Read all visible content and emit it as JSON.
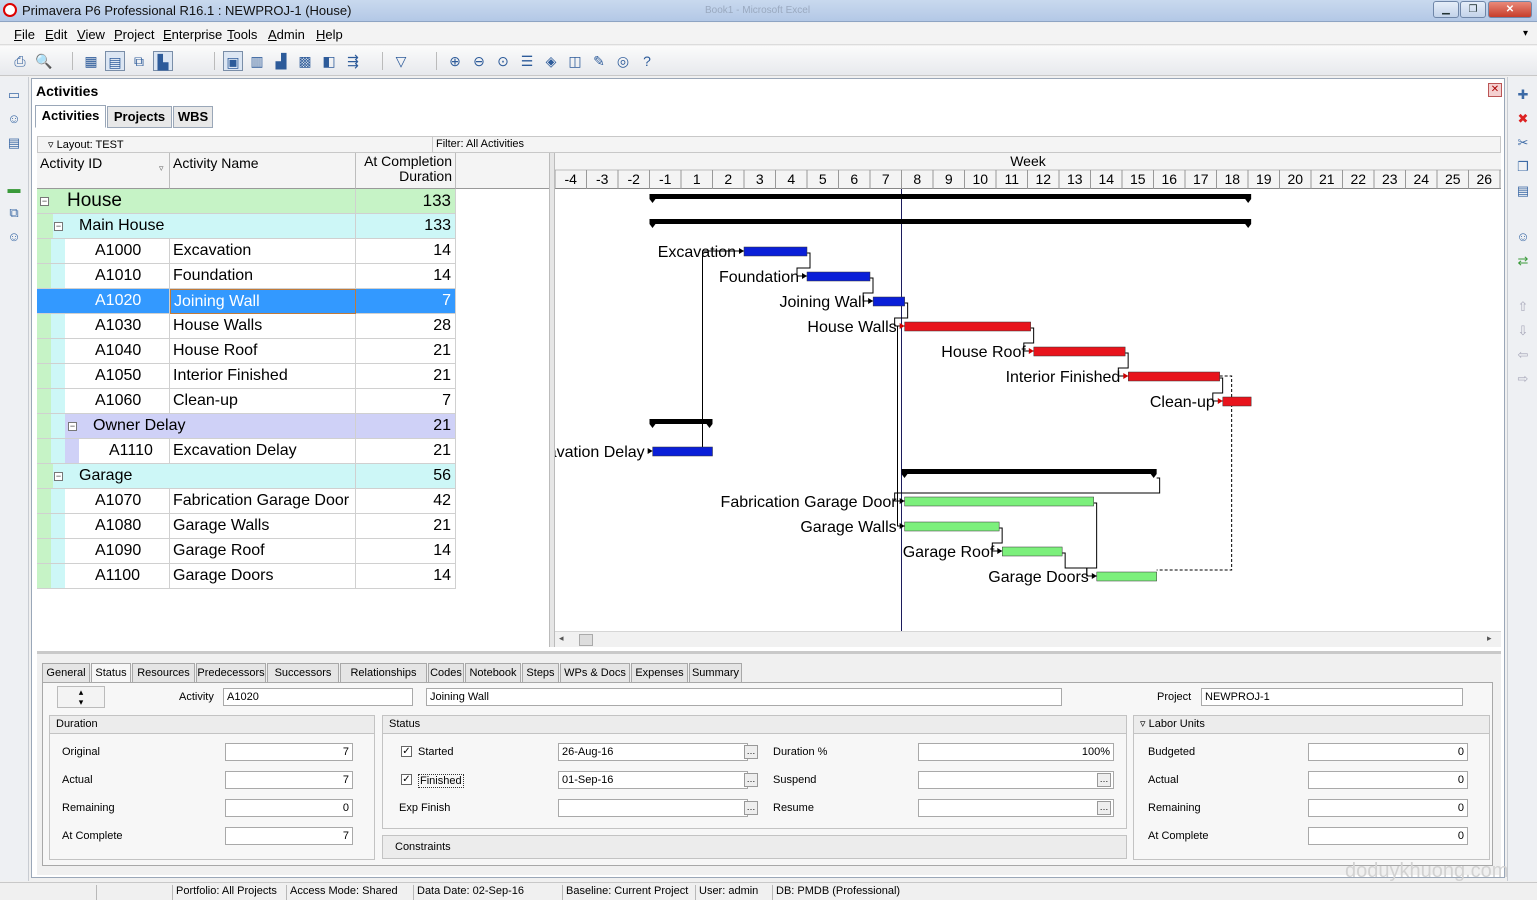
{
  "window": {
    "title": "Primavera P6 Professional R16.1 : NEWPROJ-1 (House)",
    "ghost_title": "Book1 - Microsoft Excel"
  },
  "menu": [
    {
      "first": "F",
      "rest": "ile"
    },
    {
      "first": "E",
      "rest": "dit"
    },
    {
      "first": "V",
      "rest": "iew"
    },
    {
      "first": "P",
      "rest": "roject"
    },
    {
      "first": "E",
      "rest": "nterprise"
    },
    {
      "first": "T",
      "rest": "ools"
    },
    {
      "first": "A",
      "rest": "dmin"
    },
    {
      "first": "H",
      "rest": "elp"
    }
  ],
  "panel": {
    "title": "Activities",
    "tabs": [
      "Activities",
      "Projects",
      "WBS"
    ],
    "layout_label": "Layout: TEST",
    "filter_label": "Filter: All Activities"
  },
  "columns": {
    "id": "Activity ID",
    "name": "Activity Name",
    "duration_l1": "At Completion",
    "duration_l2": "Duration"
  },
  "rows": [
    {
      "type": "wbs0",
      "id": "House",
      "name": "",
      "dur": "133"
    },
    {
      "type": "wbs1",
      "id": "Main House",
      "name": "",
      "dur": "133"
    },
    {
      "type": "act",
      "id": "A1000",
      "name": "Excavation",
      "dur": "14"
    },
    {
      "type": "act",
      "id": "A1010",
      "name": "Foundation",
      "dur": "14"
    },
    {
      "type": "act",
      "id": "A1020",
      "name": "Joining Wall",
      "dur": "7"
    },
    {
      "type": "act",
      "id": "A1030",
      "name": "House Walls",
      "dur": "28"
    },
    {
      "type": "act",
      "id": "A1040",
      "name": "House Roof",
      "dur": "21"
    },
    {
      "type": "act",
      "id": "A1050",
      "name": "Interior Finished",
      "dur": "21"
    },
    {
      "type": "act",
      "id": "A1060",
      "name": "Clean-up",
      "dur": "7"
    },
    {
      "type": "wbs2",
      "id": "Owner Delay",
      "name": "",
      "dur": "21"
    },
    {
      "type": "act2",
      "id": "A1110",
      "name": "Excavation Delay",
      "dur": "21"
    },
    {
      "type": "wbs1",
      "id": "Garage",
      "name": "",
      "dur": "56"
    },
    {
      "type": "act",
      "id": "A1070",
      "name": "Fabrication Garage Door",
      "dur": "42"
    },
    {
      "type": "act",
      "id": "A1080",
      "name": "Garage Walls",
      "dur": "21"
    },
    {
      "type": "act",
      "id": "A1090",
      "name": "Garage Roof",
      "dur": "14"
    },
    {
      "type": "act",
      "id": "A1100",
      "name": "Garage Doors",
      "dur": "14"
    }
  ],
  "selected_row": 4,
  "gantt": {
    "timescale_label": "Week",
    "weeks": [
      "-4",
      "-3",
      "-2",
      "-1",
      "1",
      "2",
      "3",
      "4",
      "5",
      "6",
      "7",
      "8",
      "9",
      "10",
      "11",
      "12",
      "13",
      "14",
      "15",
      "16",
      "17",
      "18",
      "19",
      "20",
      "21",
      "22",
      "23",
      "24",
      "25",
      "26",
      "2"
    ],
    "data_date_week": 8,
    "bars": [
      {
        "row": 0,
        "kind": "summary",
        "start": -1,
        "end": 19.1
      },
      {
        "row": 1,
        "kind": "summary",
        "start": -1,
        "end": 19.1
      },
      {
        "row": 2,
        "kind": "done",
        "start": 3,
        "end": 5,
        "label": "Excavation"
      },
      {
        "row": 3,
        "kind": "done",
        "start": 5,
        "end": 7,
        "label": "Foundation"
      },
      {
        "row": 4,
        "kind": "done",
        "start": 7.1,
        "end": 8.1,
        "label": "Joining Wall"
      },
      {
        "row": 5,
        "kind": "critical",
        "start": 8.1,
        "end": 12.1,
        "label": "House Walls"
      },
      {
        "row": 6,
        "kind": "critical",
        "start": 12.2,
        "end": 15.1,
        "label": "House Roof"
      },
      {
        "row": 7,
        "kind": "critical",
        "start": 15.2,
        "end": 18.1,
        "label": "Interior Finished"
      },
      {
        "row": 8,
        "kind": "critical",
        "start": 18.2,
        "end": 19.1,
        "label": "Clean-up"
      },
      {
        "row": 9,
        "kind": "summary",
        "start": -1,
        "end": 2
      },
      {
        "row": 10,
        "kind": "done",
        "start": -0.9,
        "end": 2,
        "label": "Excavation Delay"
      },
      {
        "row": 11,
        "kind": "summary",
        "start": 8,
        "end": 16.1
      },
      {
        "row": 12,
        "kind": "remaining",
        "start": 8.1,
        "end": 14.1,
        "label": "Fabrication Garage Door"
      },
      {
        "row": 13,
        "kind": "remaining",
        "start": 8.1,
        "end": 11.1,
        "label": "Garage Walls"
      },
      {
        "row": 14,
        "kind": "remaining",
        "start": 11.2,
        "end": 13.1,
        "label": "Garage Roof"
      },
      {
        "row": 15,
        "kind": "remaining",
        "start": 14.2,
        "end": 16.1,
        "label": "Garage Doors"
      }
    ],
    "colors": {
      "done": "#0a1fd8",
      "critical": "#e8141c",
      "remaining": "#7cf07c",
      "summary": "#000000",
      "dataline": "#1c1c5c"
    }
  },
  "details": {
    "tabs": [
      "General",
      "Status",
      "Resources",
      "Predecessors",
      "Successors",
      "Relationships",
      "Codes",
      "Notebook",
      "Steps",
      "WPs & Docs",
      "Expenses",
      "Summary"
    ],
    "active_tab": "Status",
    "activity_label": "Activity",
    "activity_id": "A1020",
    "activity_name": "Joining Wall",
    "project_label": "Project",
    "project_value": "NEWPROJ-1",
    "duration": {
      "title": "Duration",
      "original_label": "Original",
      "original": "7",
      "actual_label": "Actual",
      "actual": "7",
      "remaining_label": "Remaining",
      "remaining": "0",
      "at_complete_label": "At Complete",
      "at_complete": "7"
    },
    "status": {
      "title": "Status",
      "started_label": "Started",
      "started_date": "26-Aug-16",
      "finished_label": "Finished",
      "finished_date": "01-Sep-16",
      "exp_finish_label": "Exp Finish",
      "exp_finish": "",
      "duration_pct_label": "Duration %",
      "duration_pct": "100%",
      "suspend_label": "Suspend",
      "suspend": "",
      "resume_label": "Resume",
      "resume": ""
    },
    "constraints_label": "Constraints",
    "labor": {
      "title": "Labor Units",
      "budgeted_label": "Budgeted",
      "budgeted": "0",
      "actual_label": "Actual",
      "actual": "0",
      "remaining_label": "Remaining",
      "remaining": "0",
      "at_complete_label": "At Complete",
      "at_complete": "0"
    }
  },
  "statusbar": {
    "portfolio": "Portfolio: All Projects",
    "access": "Access Mode: Shared",
    "data_date": "Data Date: 02-Sep-16",
    "baseline": "Baseline: Current Project",
    "user": "User: admin",
    "db": "DB: PMDB (Professional)"
  },
  "watermark": "doduykhuong.com"
}
